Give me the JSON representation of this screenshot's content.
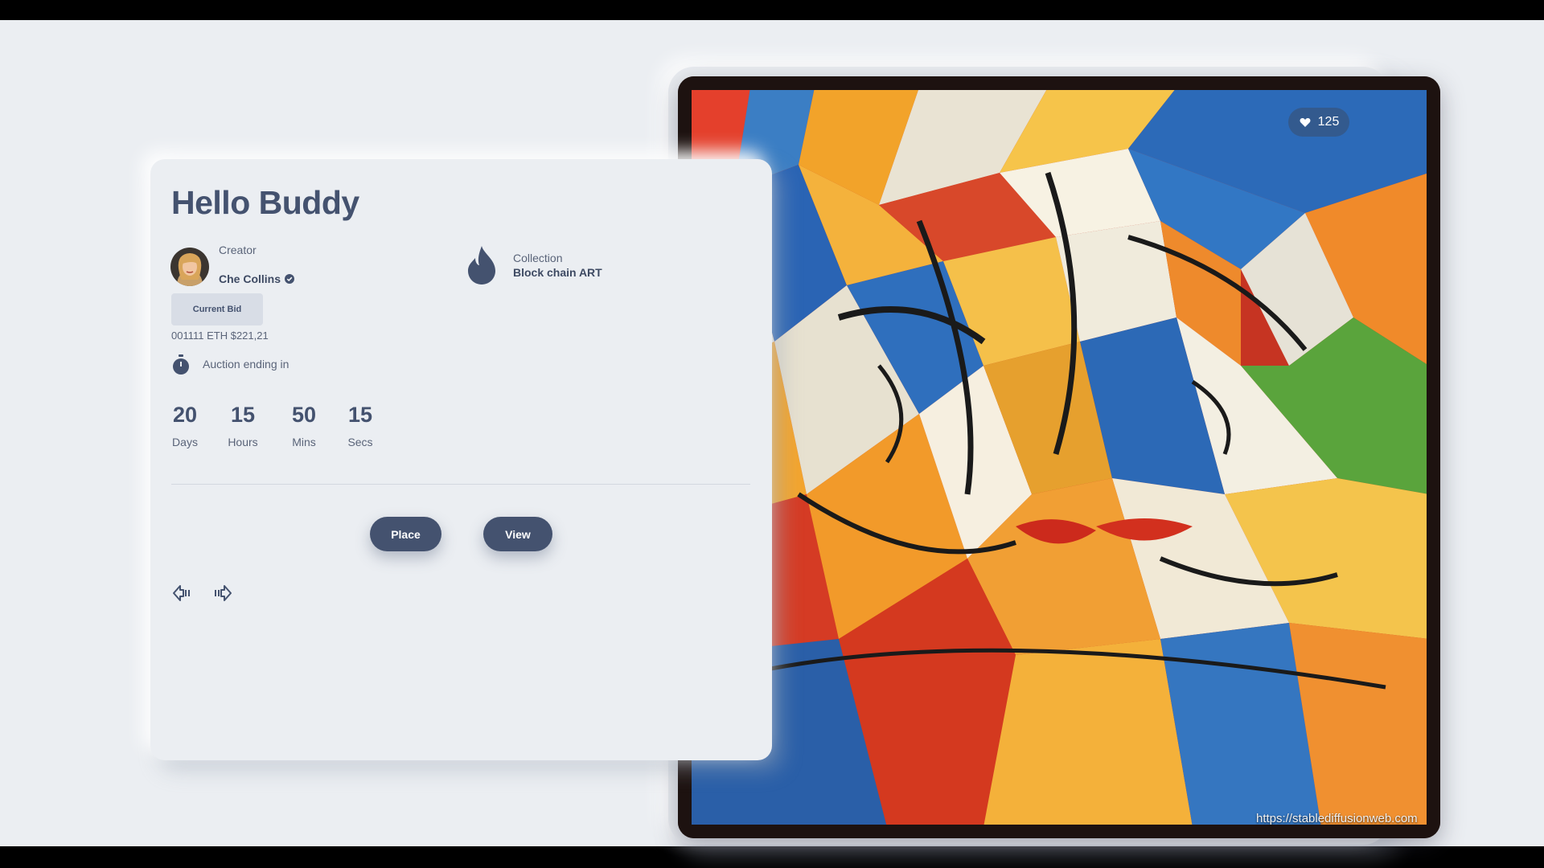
{
  "hero": {
    "title": "Hello Buddy"
  },
  "creator": {
    "label": "Creator",
    "name": "Che Collins",
    "verified_icon": "verified-check-icon"
  },
  "collection": {
    "label": "Collection",
    "name": "Block chain ART",
    "icon": "flame-icon"
  },
  "bid": {
    "badge_label": "Current Bid",
    "value": "001111 ETH $221,21"
  },
  "auction": {
    "label": "Auction ending in",
    "icon": "stopwatch-icon"
  },
  "countdown": [
    {
      "value": "20",
      "unit": "Days"
    },
    {
      "value": "15",
      "unit": "Hours"
    },
    {
      "value": "50",
      "unit": "Mins"
    },
    {
      "value": "15",
      "unit": "Secs"
    }
  ],
  "actions": {
    "place_label": "Place",
    "view_label": "View"
  },
  "nav": {
    "prev_icon": "arrow-left-icon",
    "next_icon": "arrow-right-icon"
  },
  "artwork": {
    "likes": "125",
    "like_icon": "heart-icon",
    "watermark": "https://stablediffusionweb.com"
  },
  "colors": {
    "primary": "#44526f",
    "background": "#ebeef2",
    "text_muted": "#5a6479"
  }
}
